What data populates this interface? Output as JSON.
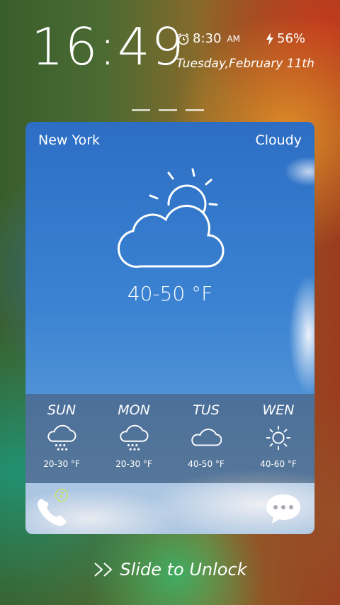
{
  "status": {
    "time": "16:49",
    "alarm_time": "8:30",
    "alarm_suffix": "AM",
    "battery": "56%",
    "date": "Tuesday,February 11th"
  },
  "weather": {
    "city": "New York",
    "condition": "Cloudy",
    "temp_range": "40-50 °F"
  },
  "forecast": [
    {
      "day": "SUN",
      "range": "20-30 °F",
      "icon": "rain-cloud-icon"
    },
    {
      "day": "MON",
      "range": "20-30 °F",
      "icon": "rain-cloud-icon"
    },
    {
      "day": "TUS",
      "range": "40-50 °F",
      "icon": "cloud-icon"
    },
    {
      "day": "WEN",
      "range": "40-60 °F",
      "icon": "sun-icon"
    }
  ],
  "shortcuts": {
    "missed_calls": "2"
  },
  "unlock_text": "Slide to Unlock"
}
